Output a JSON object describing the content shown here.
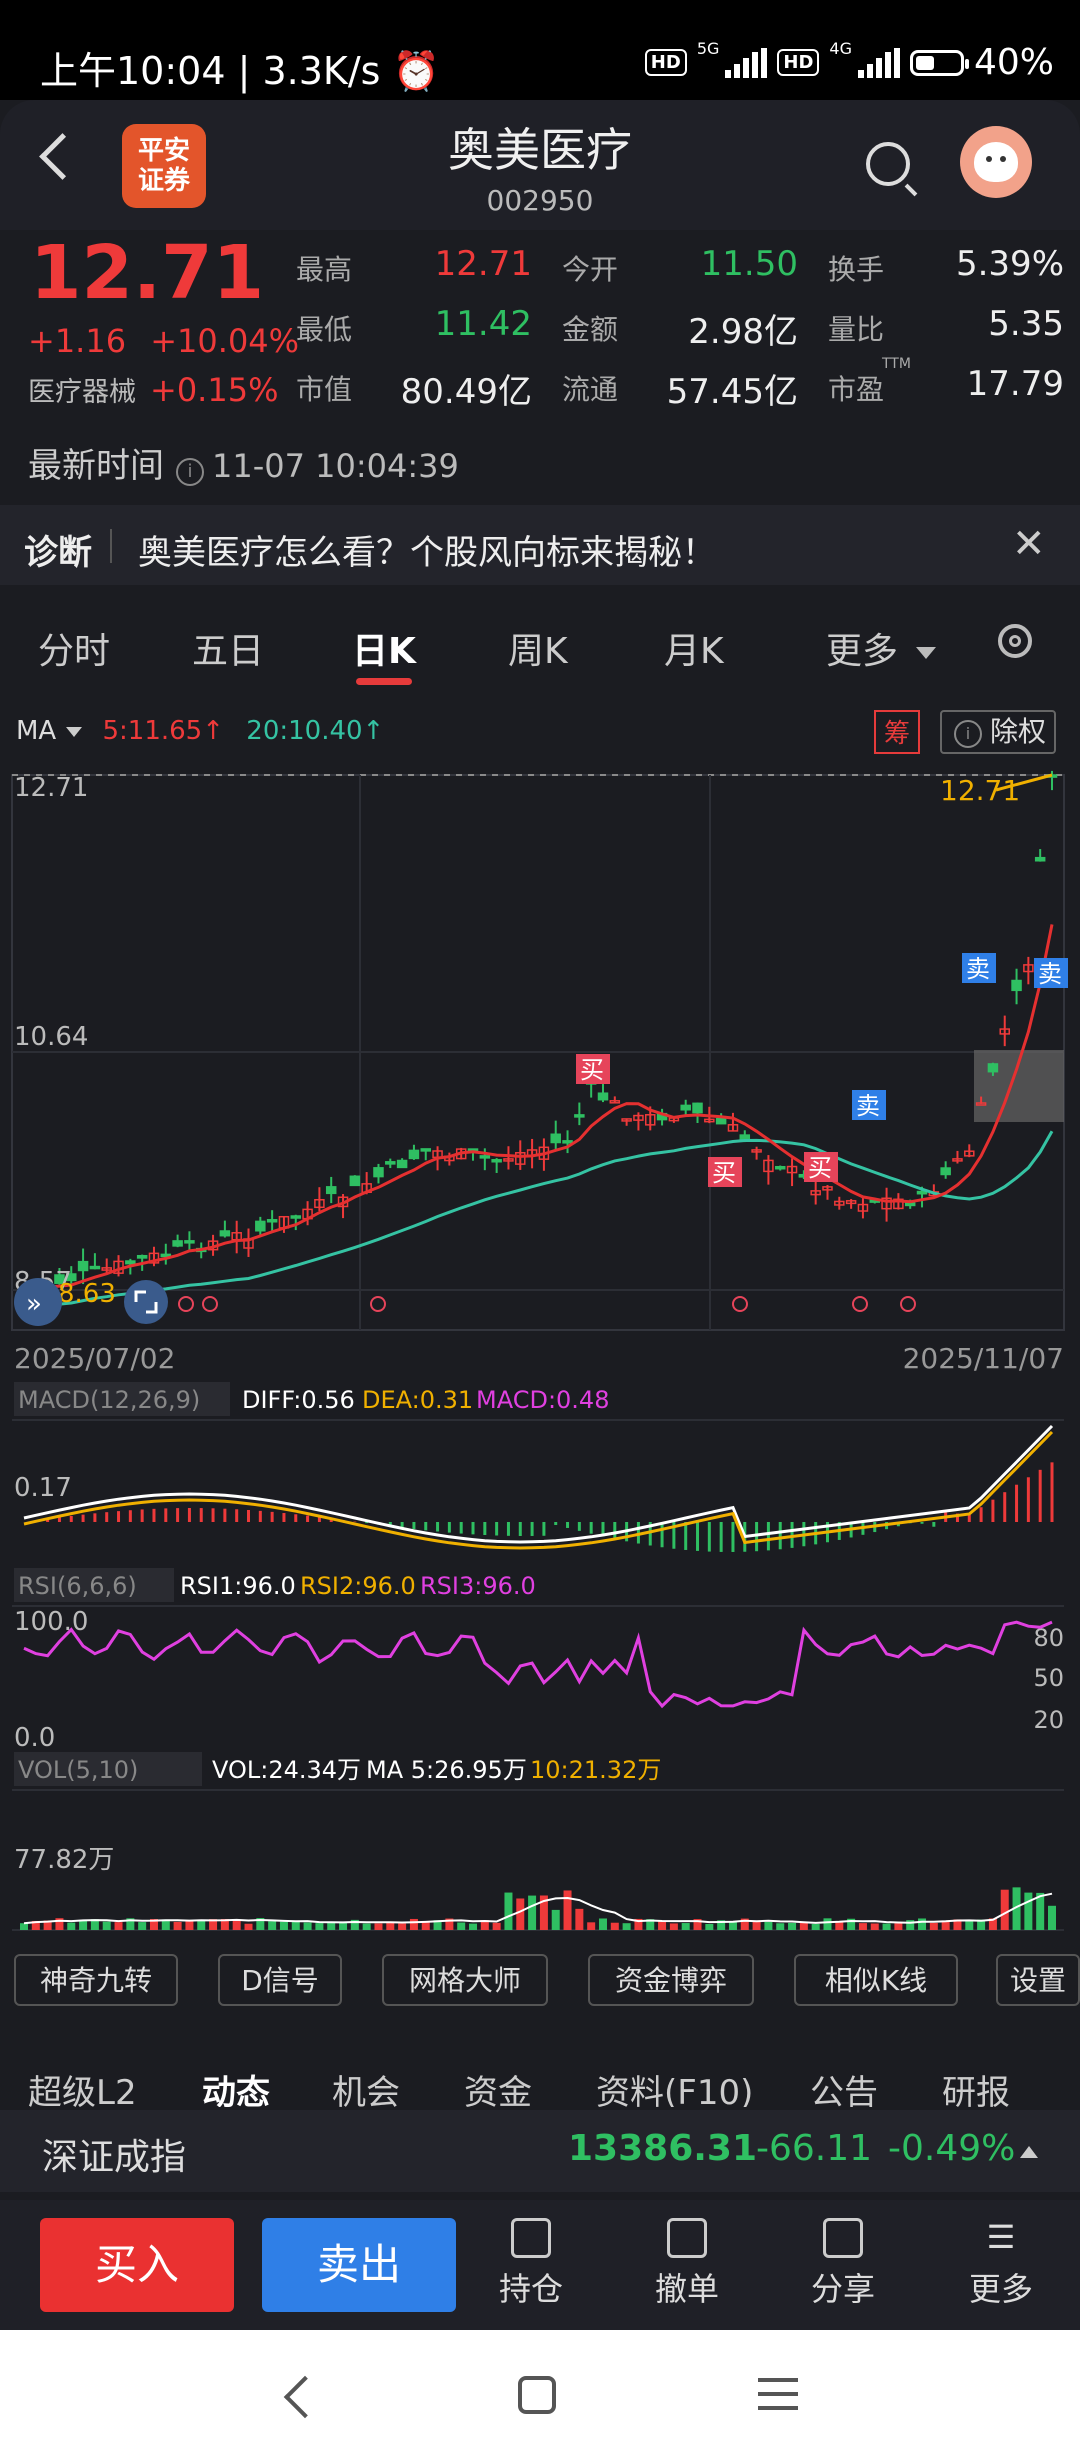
{
  "status_bar": {
    "time": "上午10:04",
    "speed": "3.3K/s",
    "net1": "5G",
    "net2": "4G",
    "battery": "40%",
    "hd": "HD"
  },
  "header": {
    "title": "奥美医疗",
    "code": "002950",
    "logo_line1": "平安",
    "logo_line2": "证券"
  },
  "quote": {
    "price": "12.71",
    "change": "+1.16",
    "change_pct": "+10.04%",
    "sector": "医疗器械",
    "sector_pct": "+0.15%",
    "fields": [
      {
        "label": "最高",
        "value": "12.71",
        "color": "red"
      },
      {
        "label": "今开",
        "value": "11.50",
        "color": "green"
      },
      {
        "label": "换手",
        "value": "5.39%",
        "color": "white"
      },
      {
        "label": "最低",
        "value": "11.42",
        "color": "green"
      },
      {
        "label": "金额",
        "value": "2.98亿",
        "color": "white"
      },
      {
        "label": "量比",
        "value": "5.35",
        "color": "white"
      },
      {
        "label": "市值",
        "value": "80.49亿",
        "color": "white"
      },
      {
        "label": "流通",
        "value": "57.45亿",
        "color": "white"
      },
      {
        "label": "市盈",
        "value": "17.79",
        "color": "white"
      }
    ],
    "ttm": "TTM",
    "latest_label": "最新时间",
    "latest_time": "11-07 10:04:39"
  },
  "diagnosis": {
    "label": "诊断",
    "text": "奥美医疗怎么看？个股风向标来揭秘！"
  },
  "tabs": [
    "分时",
    "五日",
    "日K",
    "周K",
    "月K",
    "更多"
  ],
  "ma_bar": {
    "ma": "MA",
    "ma5": "5:11.65↑",
    "ma20": "20:10.40↑",
    "chou": "筹",
    "chuquan": "除权"
  },
  "chart_labels": {
    "y_top": "12.71",
    "y_mid": "10.64",
    "y_low": "8.57",
    "price_tag": "12.71",
    "low_tag": "8.63",
    "date_start": "2025/07/02",
    "date_end": "2025/11/07",
    "buy": "买",
    "sell": "卖"
  },
  "macd": {
    "name": "MACD(12,26,9)",
    "diff": "DIFF:0.56",
    "dea": "DEA:0.31",
    "macd": "MACD:0.48",
    "axis": "0.17"
  },
  "rsi": {
    "name": "RSI(6,6,6)",
    "r1": "RSI1:96.0",
    "r2": "RSI2:96.0",
    "r3": "RSI3:96.0",
    "top": "100.0",
    "bottom": "0.0",
    "l80": "80",
    "l50": "50",
    "l20": "20"
  },
  "vol": {
    "name": "VOL(5,10)",
    "vol": "VOL:24.34万",
    "ma5": "MA 5:26.95万",
    "ma10": "10:21.32万",
    "axis": "77.82万"
  },
  "tools": [
    "神奇九转",
    "D信号",
    "网格大师",
    "资金博弈",
    "相似K线",
    "设置"
  ],
  "f_tabs": [
    "超级L2",
    "动态",
    "机会",
    "资金",
    "资料(F10)",
    "公告",
    "研报"
  ],
  "index": {
    "name": "深证成指",
    "value": "13386.31",
    "change": "-66.11",
    "pct": "-0.49%"
  },
  "bottom": {
    "buy": "买入",
    "sell": "卖出",
    "hold": "持仓",
    "cancel": "撤单",
    "share": "分享",
    "more": "更多"
  },
  "colors": {
    "up": "#ef3a3a",
    "down": "#2fbf62",
    "ma5": "#e53030",
    "ma20": "#35c3a3",
    "buy_btn": "#ea3131",
    "sell_btn": "#2f7fe7"
  }
}
